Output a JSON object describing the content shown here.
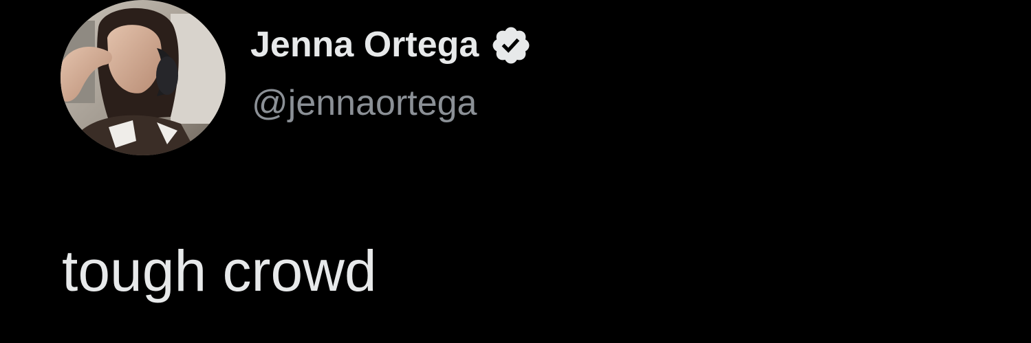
{
  "tweet": {
    "author": {
      "display_name": "Jenna Ortega",
      "handle": "@jennaortega",
      "verified": true,
      "avatar_icon": "profile-photo"
    },
    "text": "tough crowd"
  },
  "colors": {
    "background": "#000000",
    "primary_text": "#e7e9ea",
    "secondary_text": "#8b9096",
    "verified_badge": "#e7e9ea"
  }
}
